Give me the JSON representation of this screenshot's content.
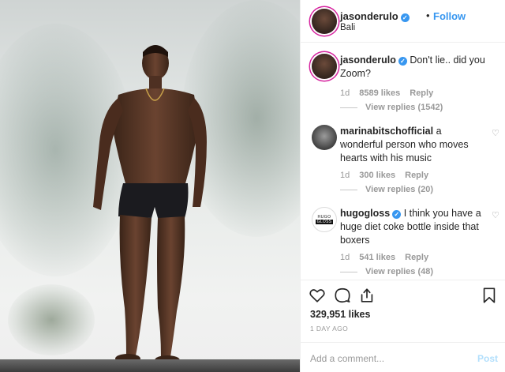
{
  "post": {
    "author": "jasonderulo",
    "verified_mark": "✓",
    "separator": "•",
    "follow_label": "Follow",
    "location": "Bali"
  },
  "photo": {
    "subject": "shirtless man in black swim trunks standing on pool ledge with misty jungle background"
  },
  "comments": [
    {
      "username": "jasonderulo",
      "verified": true,
      "text": "Don't lie.. did you Zoom?",
      "age": "1d",
      "likes": "8589 likes",
      "reply_label": "Reply",
      "view_replies": "View replies (1542)"
    },
    {
      "username": "marinabitschofficial",
      "verified": false,
      "text": "a wonderful person who moves hearts with his music",
      "age": "1d",
      "likes": "300 likes",
      "reply_label": "Reply",
      "view_replies": "View replies (20)"
    },
    {
      "username": "hugogloss",
      "verified": true,
      "text": "I think you have a huge diet coke bottle inside that boxers",
      "age": "1d",
      "likes": "541 likes",
      "reply_label": "Reply",
      "view_replies": "View replies (48)",
      "avatar_text_top": "HUGO",
      "avatar_text_bottom": "GLOSS"
    }
  ],
  "actions": {
    "like_icon": "heart-icon",
    "comment_icon": "comment-icon",
    "share_icon": "share-icon",
    "save_icon": "bookmark-icon",
    "likes_count": "329,951 likes",
    "timestamp": "1 DAY AGO"
  },
  "add_comment": {
    "placeholder": "Add a comment...",
    "post_label": "Post"
  },
  "colors": {
    "accent": "#3897f0",
    "text": "#262626",
    "muted": "#999999",
    "post_disabled": "#b2dffc"
  }
}
